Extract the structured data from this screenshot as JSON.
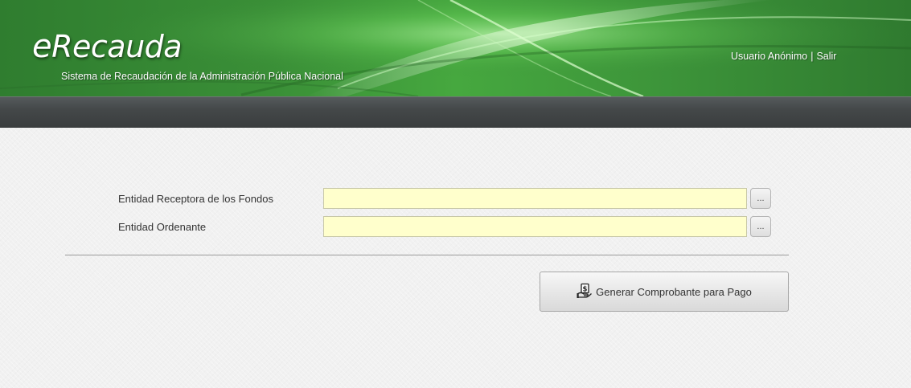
{
  "header": {
    "logo_e": "e",
    "logo_rest": "Recauda",
    "subtitle": "Sistema de Recaudación de la Administración Pública Nacional",
    "user_label": "Usuario Anónimo",
    "separator": "|",
    "logout_label": "Salir"
  },
  "form": {
    "receiving_entity_label": "Entidad Receptora de los Fondos",
    "receiving_entity_value": "",
    "ordering_entity_label": "Entidad Ordenante",
    "ordering_entity_value": "",
    "lookup_button_label": "...",
    "generate_button_label": "Generar Comprobante para Pago",
    "generate_icon": "money-hand-icon"
  },
  "colors": {
    "header_green": "#3a8f37",
    "navbar_gray": "#444849",
    "input_background": "#ffffcc"
  }
}
